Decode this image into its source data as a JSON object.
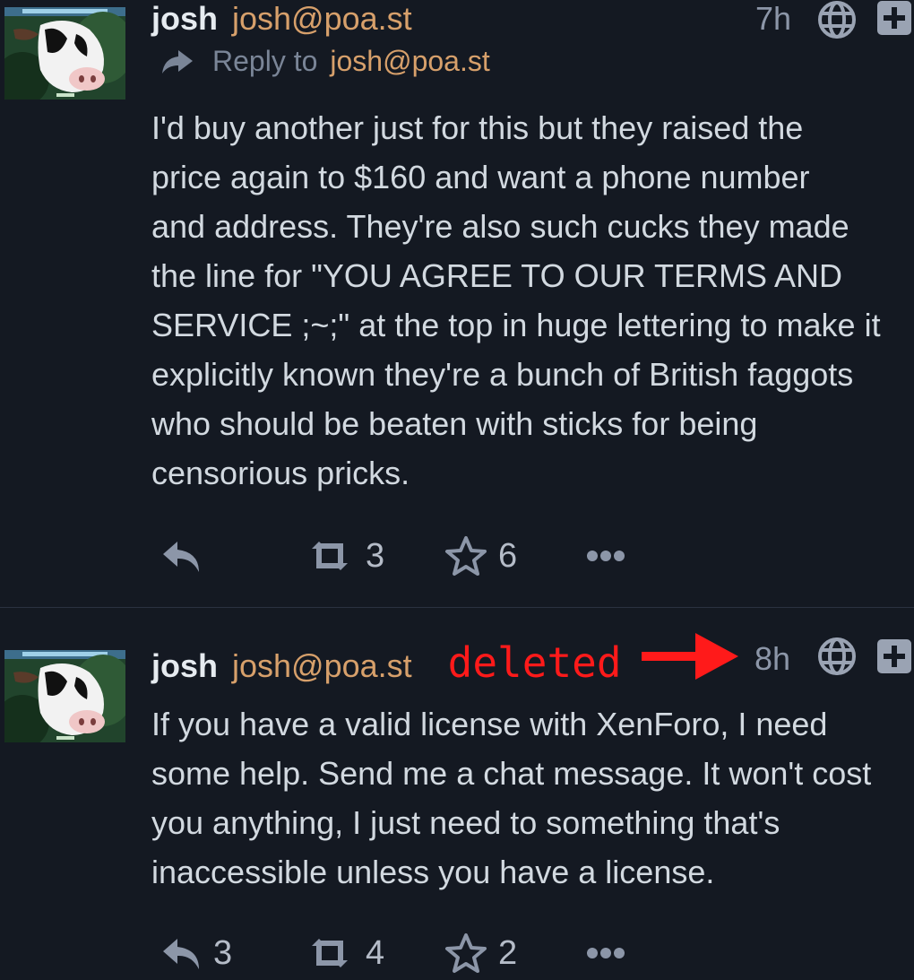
{
  "posts": [
    {
      "display_name": "josh",
      "account": "josh@poa.st",
      "time": "7h",
      "reply_to_label": "Reply to",
      "reply_to_account": "josh@poa.st",
      "content_lines": [
        "I'd buy another just for this but they raised the",
        "price again to $160 and want a phone number",
        "and address. They're also such cucks they made",
        "the line for \"YOU AGREE TO OUR TERMS AND",
        "SERVICE ;~;\" at the top in huge lettering to make it",
        "explicitly known they're a bunch of British faggots",
        "who should be beaten with sticks for being",
        "censorious pricks."
      ],
      "replies": "",
      "boosts": "3",
      "favourites": "6"
    },
    {
      "display_name": "josh",
      "account": "josh@poa.st",
      "time": "8h",
      "annotation": "deleted",
      "content_lines": [
        "If you have a valid license with XenForo, I need",
        "some help. Send me a chat message. It won't cost",
        "you anything, I just need to something that's",
        "inaccessible unless you have a license."
      ],
      "replies": "3",
      "boosts": "4",
      "favourites": "2"
    }
  ],
  "icons": {
    "reply": "reply-icon",
    "boost": "boost-icon",
    "favourite": "star-icon",
    "more": "more-icon",
    "visibility": "globe-icon",
    "expand": "plus-icon"
  },
  "colors": {
    "background": "#141922",
    "account": "#d7a06b",
    "muted": "#8c96a8",
    "annotation": "#ff1a1a"
  }
}
